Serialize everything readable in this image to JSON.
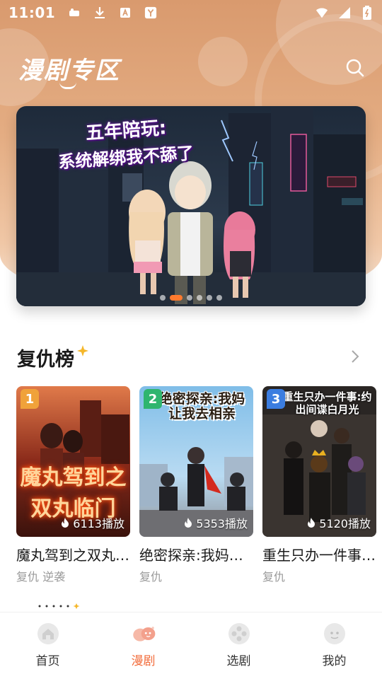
{
  "status_bar": {
    "time": "11:01"
  },
  "header": {
    "title": "漫剧专区"
  },
  "banner": {
    "title_line1": "五年陪玩:",
    "title_line2": "系统解绑我不舔了",
    "slide_count": 6,
    "active_slide": 2
  },
  "section": {
    "title": "复仇榜",
    "cards": [
      {
        "rank": "1",
        "cover_text": "魔丸驾到之双丸临门",
        "play_count": "6113播放",
        "title": "魔丸驾到之双丸临门",
        "tags": "复仇 逆袭",
        "badge_color": "#f0a23a"
      },
      {
        "rank": "2",
        "cover_text": "绝密探亲:我妈让我去相亲",
        "play_count": "5353播放",
        "title": "绝密探亲:我妈让我去相亲",
        "tags": "复仇",
        "badge_color": "#2fb56f"
      },
      {
        "rank": "3",
        "cover_text": "重生只办一件事:约出间谍白月光",
        "play_count": "5120播放",
        "title": "重生只办一件事:约出间谍白月光",
        "tags": "复仇",
        "badge_color": "#3b7de0"
      }
    ]
  },
  "bottom_nav": {
    "items": [
      {
        "label": "首页",
        "icon": "home-icon"
      },
      {
        "label": "漫剧",
        "icon": "manju-icon",
        "active": true
      },
      {
        "label": "选剧",
        "icon": "film-reel-icon"
      },
      {
        "label": "我的",
        "icon": "profile-icon"
      }
    ]
  },
  "colors": {
    "accent": "#f26b3a",
    "header_bg": "#e4ad83"
  }
}
